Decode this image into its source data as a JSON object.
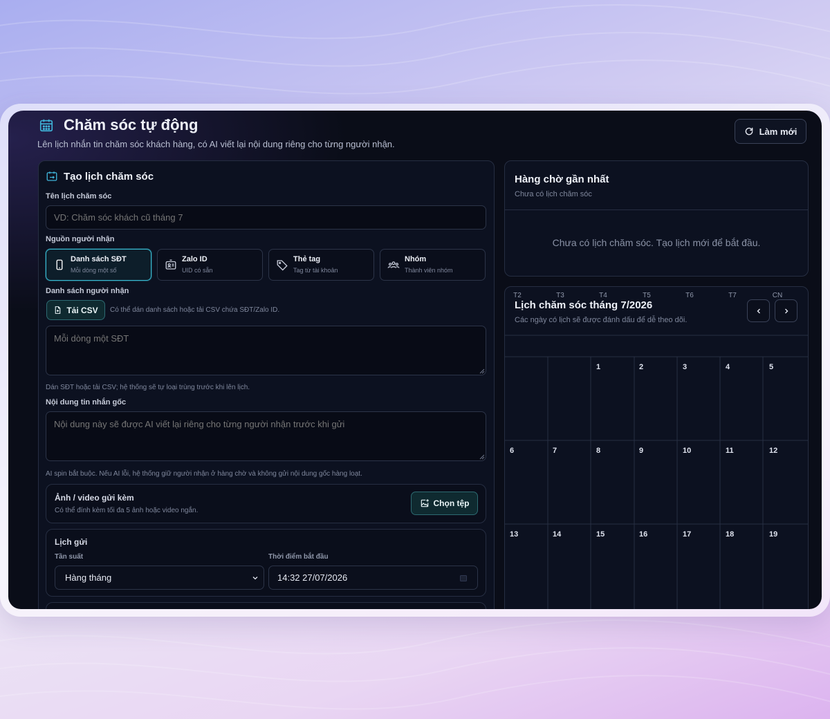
{
  "header": {
    "title": "Chăm sóc tự động",
    "subtitle": "Lên lịch nhắn tin chăm sóc khách hàng, có AI viết lại nội dung riêng cho từng người nhận.",
    "refresh_label": "Làm mới"
  },
  "create_panel": {
    "title": "Tạo lịch chăm sóc",
    "name_label": "Tên lịch chăm sóc",
    "name_placeholder": "VD: Chăm sóc khách cũ tháng 7",
    "source_label": "Nguồn người nhận",
    "sources": [
      {
        "title": "Danh sách SĐT",
        "desc": "Mỗi dòng một số",
        "icon": "phone-icon"
      },
      {
        "title": "Zalo ID",
        "desc": "UID có sẵn",
        "icon": "id-card-icon"
      },
      {
        "title": "Thẻ tag",
        "desc": "Tag từ tài khoản",
        "icon": "tag-icon"
      },
      {
        "title": "Nhóm",
        "desc": "Thành viên nhóm",
        "icon": "group-icon"
      }
    ],
    "recipients_label": "Danh sách người nhận",
    "csv_button": "Tải CSV",
    "csv_hint": "Có thể dán danh sách hoặc tải CSV chứa SĐT/Zalo ID.",
    "recipients_placeholder": "Mỗi dòng một SĐT",
    "recipients_hint": "Dán SĐT hoặc tải CSV; hệ thống sẽ tự loại trùng trước khi lên lịch.",
    "content_label": "Nội dung tin nhắn gốc",
    "content_placeholder": "Nội dung này sẽ được AI viết lại riêng cho từng người nhận trước khi gửi",
    "content_hint": "AI spin bắt buộc. Nếu AI lỗi, hệ thống giữ người nhận ở hàng chờ và không gửi nội dung gốc hàng loạt.",
    "media": {
      "title": "Ảnh / video gửi kèm",
      "desc": "Có thể đính kèm tối đa 5 ảnh hoặc video ngắn.",
      "button": "Chọn tệp"
    },
    "schedule": {
      "title": "Lịch gửi",
      "freq_label": "Tần suất",
      "freq_value": "Hàng tháng",
      "start_label": "Thời điểm bắt đầu",
      "start_value": "14:32 27/07/2026"
    }
  },
  "queue_panel": {
    "title": "Hàng chờ gần nhất",
    "subtitle": "Chưa có lịch chăm sóc",
    "empty": "Chưa có lịch chăm sóc. Tạo lịch mới để bắt đầu."
  },
  "calendar": {
    "title": "Lịch chăm sóc tháng 7/2026",
    "subtitle": "Các ngày có lịch sẽ được đánh dấu để dễ theo dõi.",
    "weekdays": [
      "T2",
      "T3",
      "T4",
      "T5",
      "T6",
      "T7",
      "CN"
    ],
    "weeks": [
      [
        "",
        "",
        "1",
        "2",
        "3",
        "4",
        "5"
      ],
      [
        "6",
        "7",
        "8",
        "9",
        "10",
        "11",
        "12"
      ],
      [
        "13",
        "14",
        "15",
        "16",
        "17",
        "18",
        "19"
      ]
    ]
  },
  "colors": {
    "accent": "#38b8d0",
    "background": "#0a0d18",
    "panel": "#0c1120",
    "border": "#262e42"
  }
}
